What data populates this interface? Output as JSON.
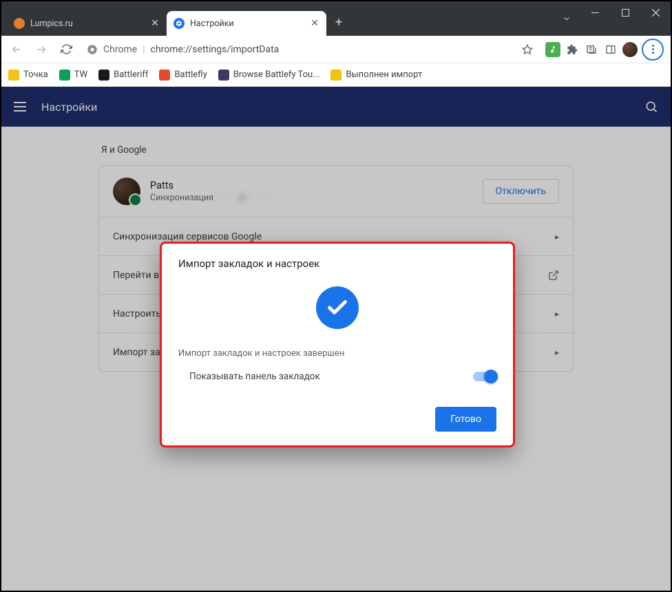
{
  "window": {
    "minimize": "—",
    "maximize": "☐",
    "close": "✕"
  },
  "tabs": [
    {
      "title": "Lumpics.ru",
      "active": false,
      "favColor": "#e07f2e"
    },
    {
      "title": "Настройки",
      "active": true,
      "favColor": "#1a73e8"
    }
  ],
  "omnibox": {
    "site_label": "Chrome",
    "url": "chrome://settings/importData"
  },
  "bookmarks": [
    {
      "label": "Точка",
      "color": "#f4c20d"
    },
    {
      "label": "TW",
      "color": "#0f9d58"
    },
    {
      "label": "Battleriff",
      "color": "#1a1a1a"
    },
    {
      "label": "Battlefly",
      "color": "#e34b2a"
    },
    {
      "label": "Browse Battlefy Tou...",
      "color": "#3a3a6a"
    },
    {
      "label": "Выполнен импорт",
      "color": "#f4c20d"
    }
  ],
  "settings": {
    "header_title": "Настройки",
    "section": "Я и Google",
    "profile": {
      "name": "Patts",
      "sync_label": "Синхронизация",
      "sync_email_blur": "· ···· ··@····· ····",
      "disconnect": "Отключить"
    },
    "rows": {
      "sync": "Синхронизация сервисов Google",
      "goto": "Перейти в",
      "customize": "Настроить",
      "import": "Импорт за"
    }
  },
  "dialog": {
    "title": "Импорт закладок и настроек",
    "message": "Импорт закладок и настроек завершен",
    "toggle_label": "Показывать панель закладок",
    "done": "Готово"
  }
}
